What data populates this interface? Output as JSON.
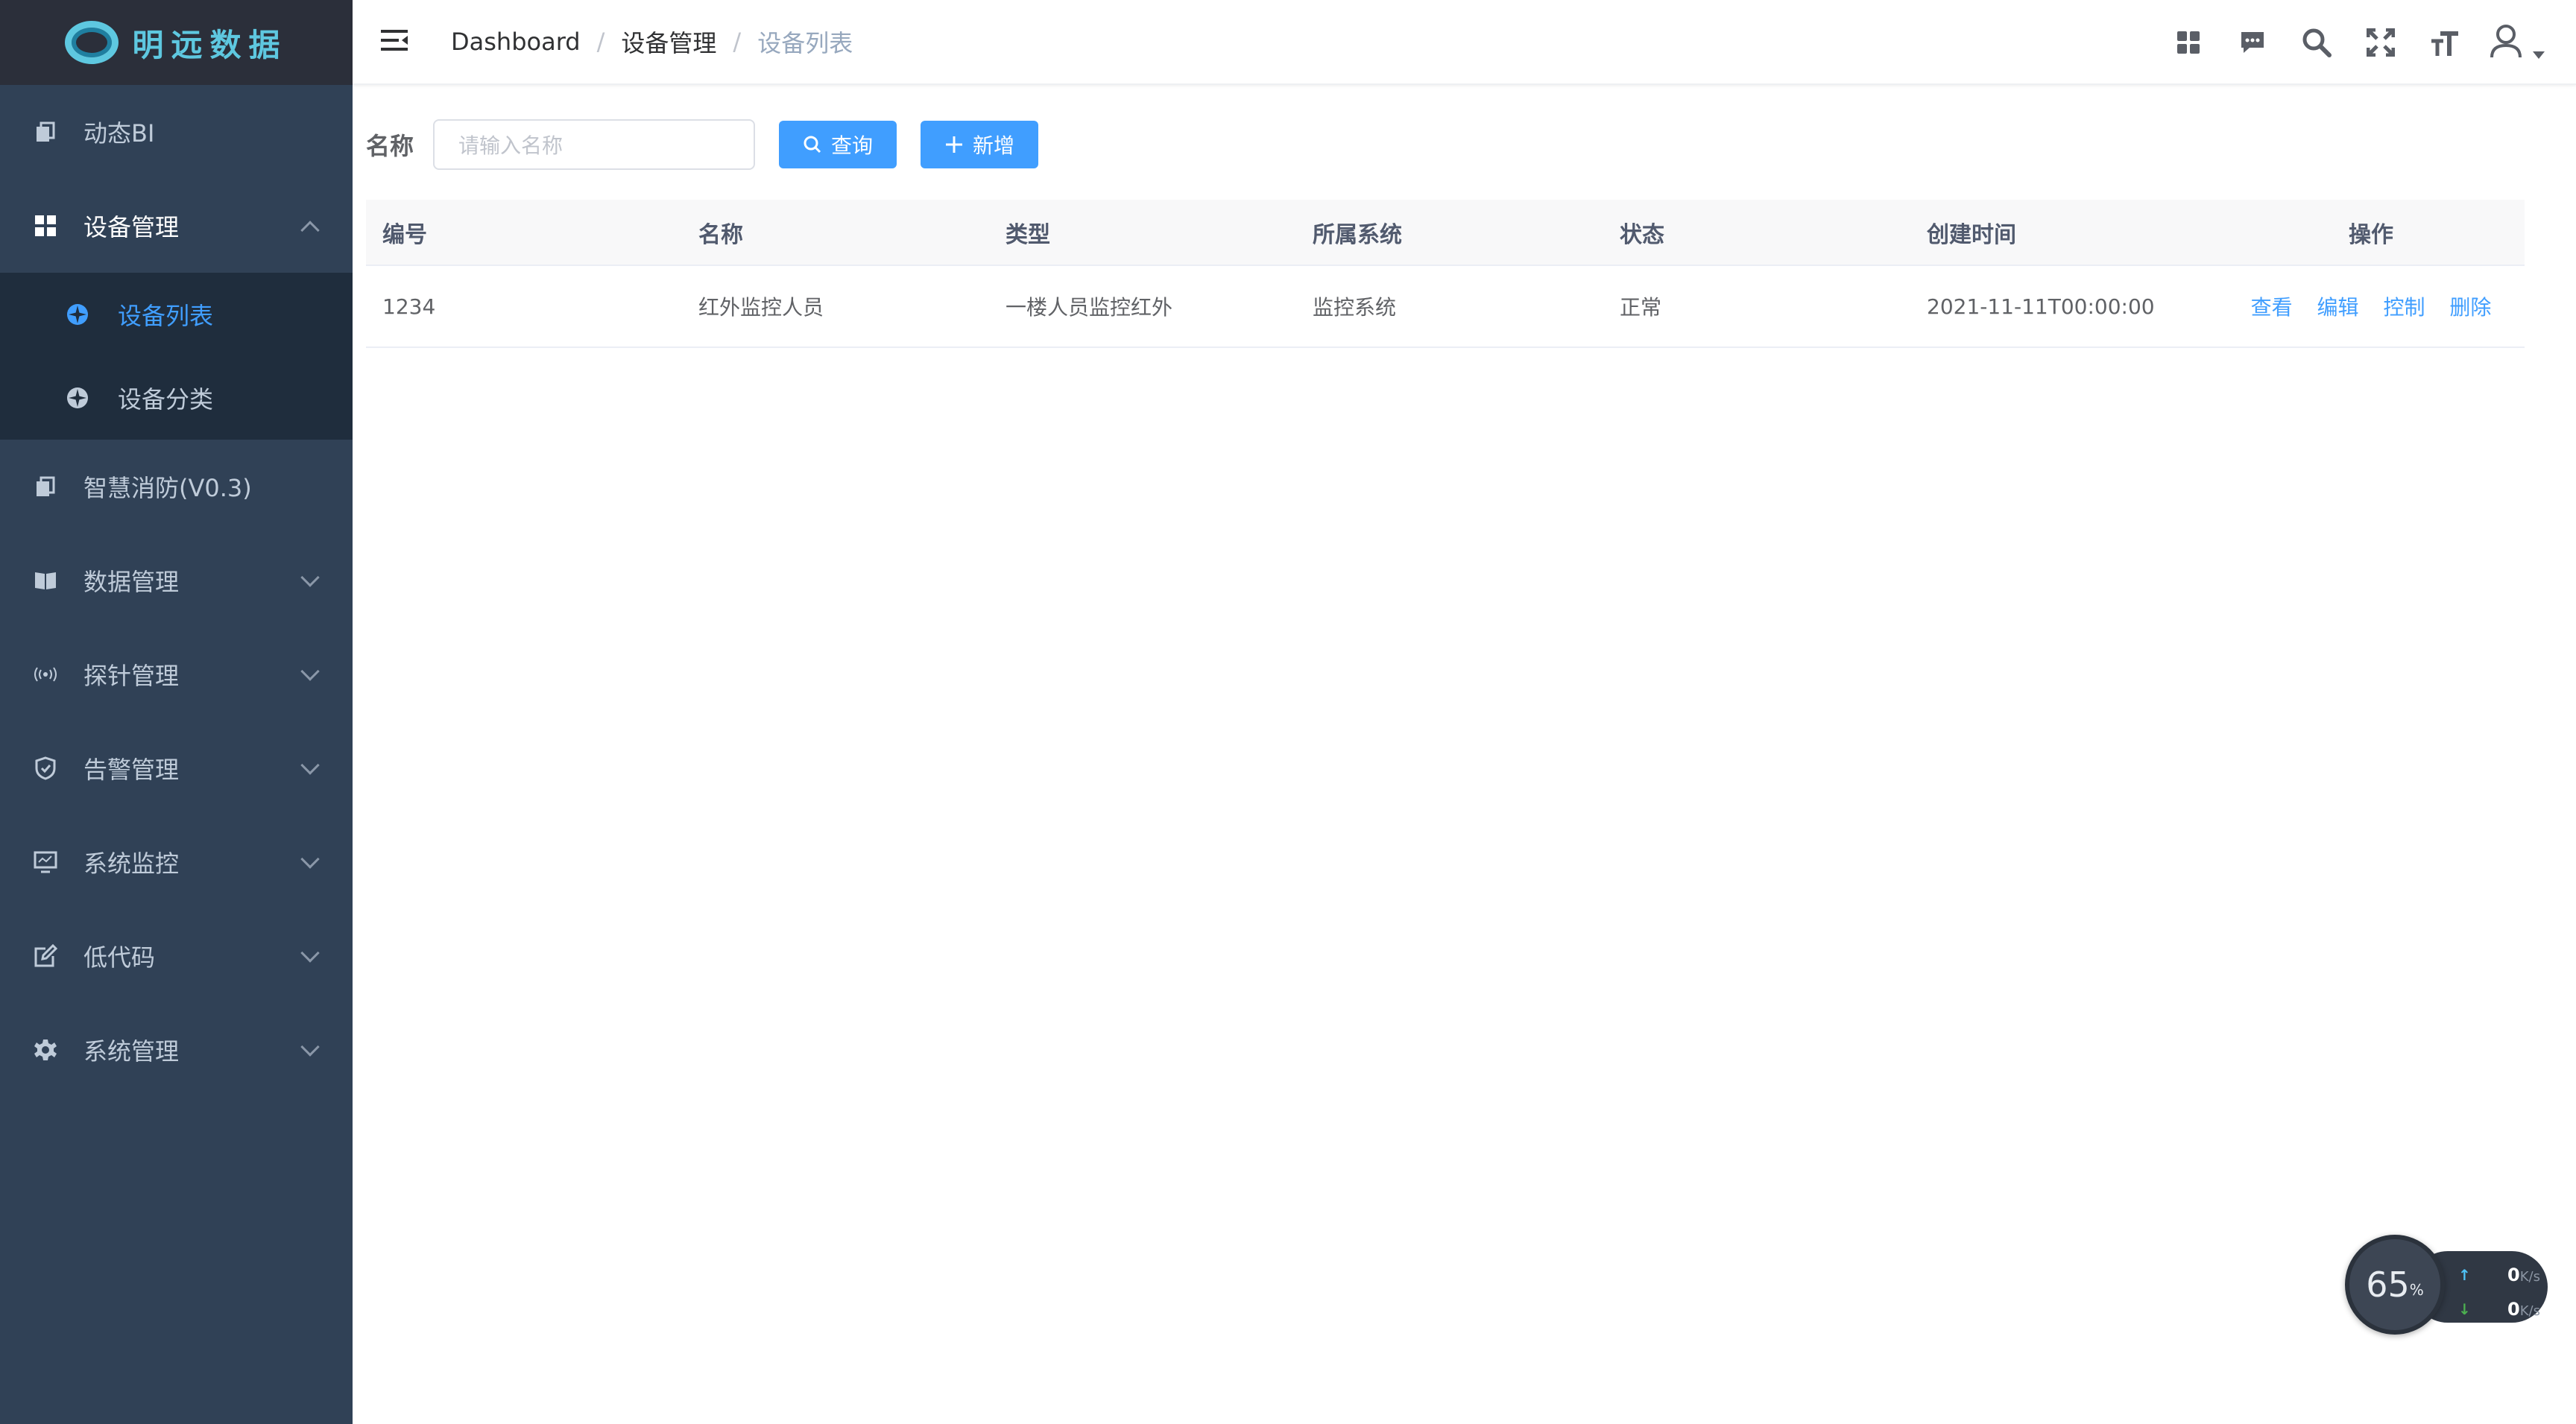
{
  "app": {
    "logo_text": "明远数据"
  },
  "sidebar": {
    "items": [
      {
        "label": "动态BI",
        "icon": "copy-icon",
        "expandable": false
      },
      {
        "label": "设备管理",
        "icon": "grid-icon",
        "expandable": true,
        "open": true,
        "children": [
          {
            "label": "设备列表",
            "icon": "compass-icon",
            "active": true
          },
          {
            "label": "设备分类",
            "icon": "compass-icon",
            "active": false
          }
        ]
      },
      {
        "label": "智慧消防(V0.3)",
        "icon": "copy-icon",
        "expandable": false
      },
      {
        "label": "数据管理",
        "icon": "book-icon",
        "expandable": true
      },
      {
        "label": "探针管理",
        "icon": "signal-icon",
        "expandable": true
      },
      {
        "label": "告警管理",
        "icon": "shield-icon",
        "expandable": true
      },
      {
        "label": "系统监控",
        "icon": "monitor-icon",
        "expandable": true
      },
      {
        "label": "低代码",
        "icon": "edit-icon",
        "expandable": true
      },
      {
        "label": "系统管理",
        "icon": "gear-icon",
        "expandable": true
      }
    ]
  },
  "breadcrumb": [
    "Dashboard",
    "设备管理",
    "设备列表"
  ],
  "header_icons": [
    "apps-icon",
    "message-icon",
    "search-icon",
    "fullscreen-icon",
    "font-size-icon",
    "user-icon"
  ],
  "search": {
    "label": "名称",
    "placeholder": "请输入名称",
    "query_label": "查询",
    "add_label": "新增"
  },
  "table": {
    "columns": [
      "编号",
      "名称",
      "类型",
      "所属系统",
      "状态",
      "创建时间",
      "操作"
    ],
    "rows": [
      {
        "id": "1234",
        "name": "红外监控人员",
        "type": "一楼人员监控红外",
        "system": "监控系统",
        "status": "正常",
        "created": "2021-11-11T00:00:00"
      }
    ],
    "actions": [
      "查看",
      "编辑",
      "控制",
      "删除"
    ]
  },
  "net_widget": {
    "percent": "65",
    "percent_unit": "%",
    "up": "0",
    "down": "0",
    "unit": "K/s",
    "up_color": "#4fc3f7",
    "down_color": "#4caf50"
  },
  "colors": {
    "sidebar": "#304156",
    "submenu": "#1f2d3d",
    "accent": "#409eff",
    "logo": "#5ec8e0"
  }
}
